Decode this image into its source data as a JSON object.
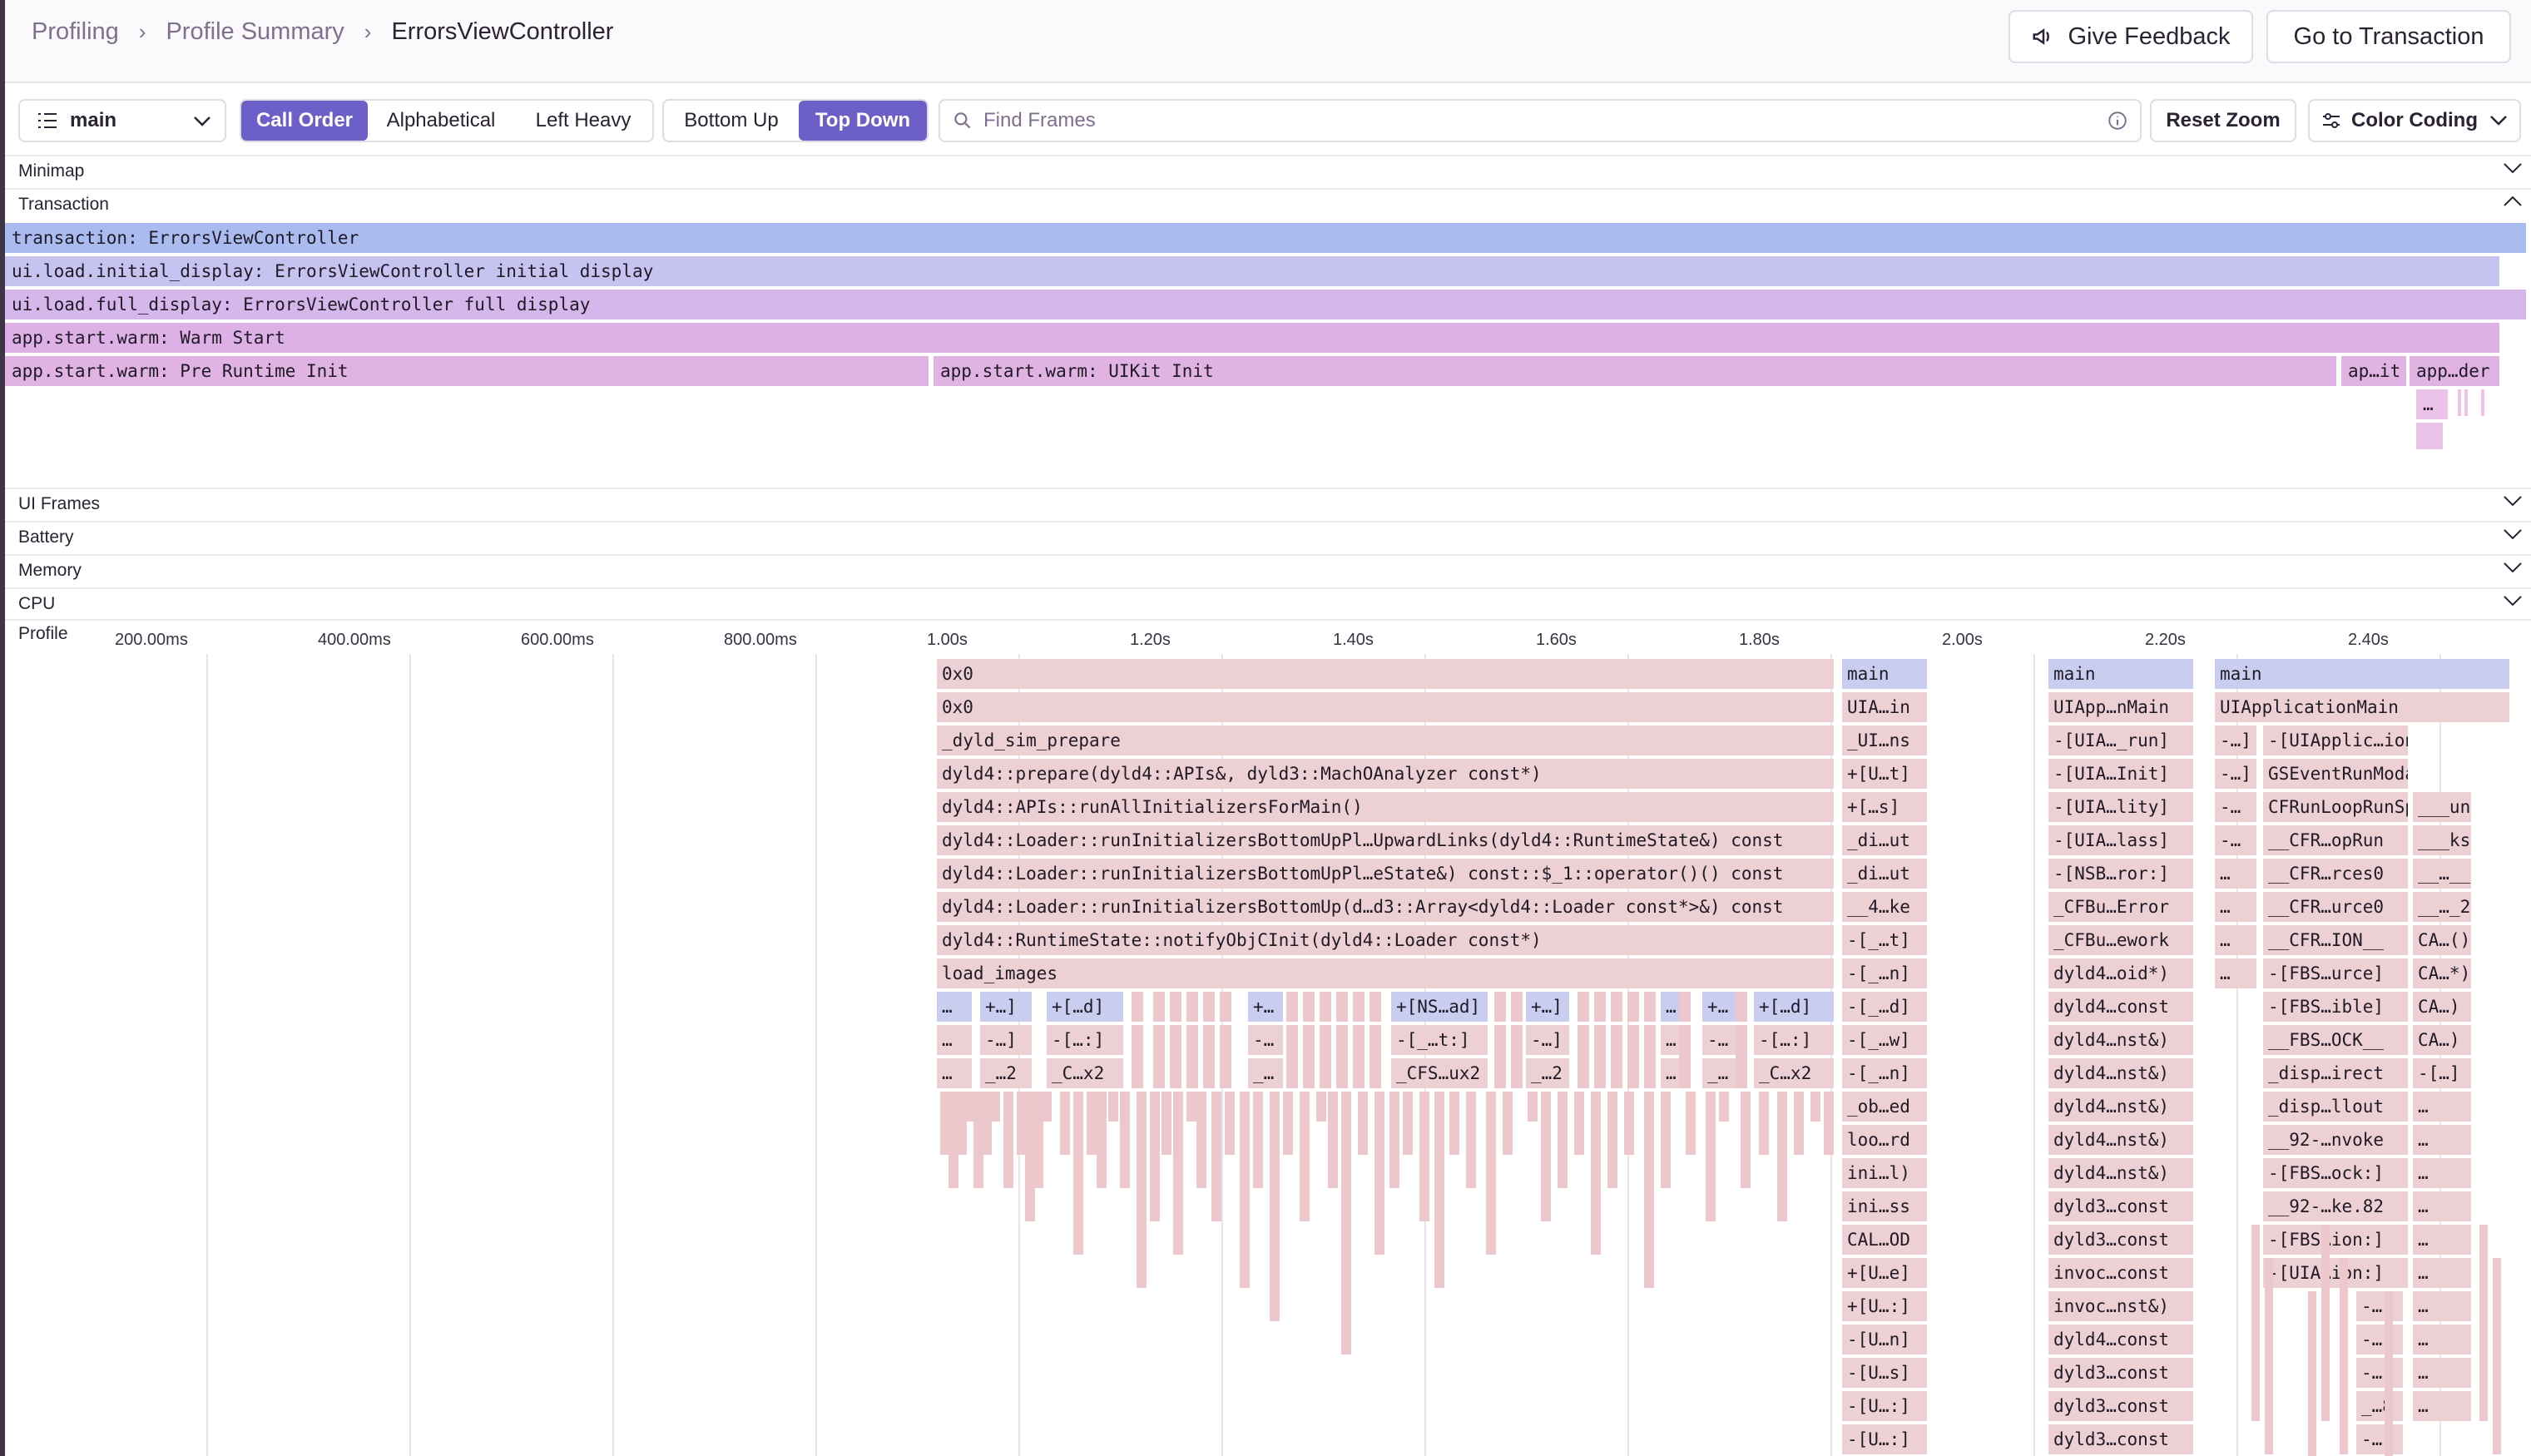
{
  "breadcrumbs": [
    "Profiling",
    "Profile Summary",
    "ErrorsViewController"
  ],
  "header_buttons": {
    "feedback": "Give Feedback",
    "transaction": "Go to Transaction"
  },
  "toolbar": {
    "thread": "main",
    "sort_options": [
      "Call Order",
      "Alphabetical",
      "Left Heavy"
    ],
    "sort_selected": "Call Order",
    "view_options": [
      "Bottom Up",
      "Top Down"
    ],
    "view_selected": "Top Down",
    "search_placeholder": "Find Frames",
    "reset_zoom": "Reset Zoom",
    "color_coding": "Color Coding"
  },
  "sections": {
    "minimap": "Minimap",
    "transaction": "Transaction",
    "ui_frames": "UI Frames",
    "battery": "Battery",
    "memory": "Memory",
    "cpu": "CPU",
    "profile": "Profile"
  },
  "spans": [
    "transaction: ErrorsViewController",
    "ui.load.initial_display: ErrorsViewController initial display",
    "ui.load.full_display: ErrorsViewController full display",
    "app.start.warm: Warm Start",
    "app.start.warm: Pre Runtime Init",
    "app.start.warm: UIKit Init",
    "ap…it",
    "app…der",
    "…"
  ],
  "axis_ticks": [
    "200.00ms",
    "400.00ms",
    "600.00ms",
    "800.00ms",
    "1.00s",
    "1.20s",
    "1.40s",
    "1.60s",
    "1.80s",
    "2.00s",
    "2.20s",
    "2.40s"
  ],
  "flame_stack_a": [
    "0x0",
    "0x0",
    "_dyld_sim_prepare",
    "dyld4::prepare(dyld4::APIs&, dyld3::MachOAnalyzer const*)",
    "dyld4::APIs::runAllInitializersForMain()",
    "dyld4::Loader::runInitializersBottomUpPl…UpwardLinks(dyld4::RuntimeState&) const",
    "dyld4::Loader::runInitializersBottomUpPl…eState&) const::$_1::operator()() const",
    "dyld4::Loader::runInitializersBottomUp(d…d3::Array<dyld4::Loader const*>&) const",
    "dyld4::RuntimeState::notifyObjCInit(dyld4::Loader const*)",
    "load_images"
  ],
  "flame_small_row1": [
    "…",
    "+…]",
    "+[…d]",
    "+…",
    "+[NS…ad]",
    "+…]",
    "…",
    "+…",
    "+[…d]"
  ],
  "flame_small_row2": [
    "…",
    "-…]",
    "-[…:]",
    "-…",
    "-[_…t:]",
    "-…]",
    "…",
    "-…",
    "-[…:]"
  ],
  "flame_small_row3": [
    "…",
    "_…2",
    "_C…x2",
    "_…",
    "_CFS…ux2",
    "_…2",
    "…",
    "_…",
    "_C…x2"
  ],
  "flame_stack_b": [
    "main",
    "UIA…in",
    "_UI…ns",
    "+[U…t]",
    "+[…s]",
    "_di…ut",
    "_di…ut",
    "__4…ke",
    "-[_…t]",
    "-[_…n]",
    "-[_…d]",
    "-[_…w]",
    "-[_…n]",
    "_ob…ed",
    "loo…rd",
    "ini…l)",
    "ini…ss",
    "CAL…OD",
    "+[U…e]",
    "+[U…:]",
    "-[U…n]",
    "-[U…s]",
    "-[U…:]",
    "-[U…:]"
  ],
  "flame_stack_c": [
    "main",
    "UIApp…nMain",
    "-[UIA…_run]",
    "-[UIA…Init]",
    "-[UIA…lity]",
    "-[UIA…lass]",
    "-[NSB…ror:]",
    "_CFBu…Error",
    "_CFBu…ework",
    "dyld4…oid*)",
    "dyld4…const",
    "dyld4…nst&)",
    "dyld4…nst&)",
    "dyld4…nst&)",
    "dyld4…nst&)",
    "dyld4…nst&)",
    "dyld3…const",
    "dyld3…const",
    "invoc…const",
    "invoc…nst&)",
    "dyld4…const",
    "dyld3…const",
    "dyld3…const",
    "dyld3…const"
  ],
  "flame_stack_d": [
    "main",
    "UIApplicationMain"
  ],
  "flame_stack_d_left": [
    "-…]",
    "-…]",
    "-…",
    "-…",
    "…",
    "…",
    "…",
    "…"
  ],
  "flame_stack_d_mid": [
    "-[UIApplic…ion _run]",
    "GSEventRunModal",
    "CFRunLoopRunSpecific",
    "__CFR…opRun",
    "__CFR…rces0",
    "__CFR…urce0",
    "__CFR…ION__",
    "-[FBS…urce]",
    "-[FBS…ible]",
    "__FBS…OCK__",
    "_disp…irect",
    "_disp…llout",
    "__92-…nvoke",
    "-[FBS…ock:]",
    "__92-…ke.82",
    "-[FBS…ion:]",
    "-[UIA…ion:]"
  ],
  "flame_stack_d_right": [
    "___un",
    "___ks",
    "__…__",
    "__…_2",
    "CA…()",
    "CA…*)",
    "CA…)",
    "CA…)",
    "-[…]",
    "…",
    "…",
    "…",
    "…",
    "…",
    "…",
    "…",
    "…",
    "…",
    "…"
  ],
  "flame_stack_d_tail": [
    "-…]",
    "-…]",
    "-…]",
    "_…8",
    "-…]"
  ]
}
